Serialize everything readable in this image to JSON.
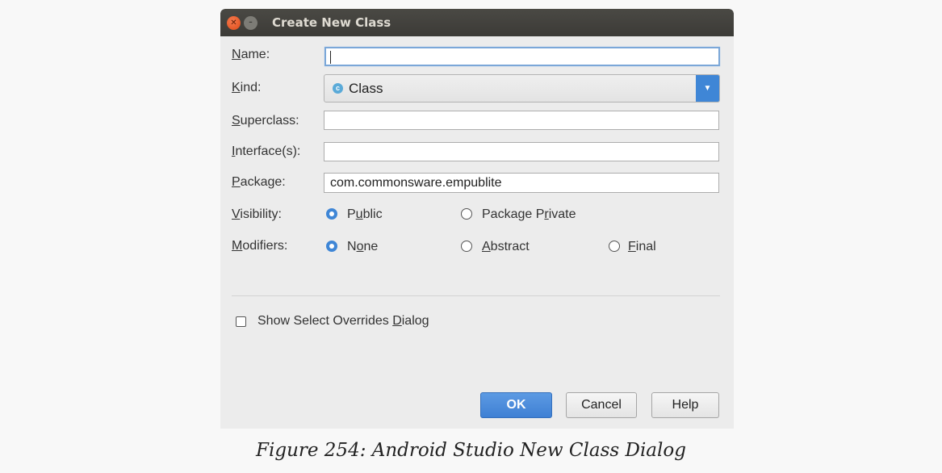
{
  "window": {
    "title": "Create New Class",
    "close_glyph": "✕",
    "minimize_glyph": "–"
  },
  "form": {
    "name": {
      "label_access": "N",
      "label_rest": "ame:",
      "value": ""
    },
    "kind": {
      "label_access": "K",
      "label_rest": "ind:",
      "icon_glyph": "c",
      "value": "Class",
      "arrow_glyph": "▼"
    },
    "superclass": {
      "label_access": "S",
      "label_rest": "uperclass:",
      "value": ""
    },
    "interfaces": {
      "label_access": "I",
      "label_rest": "nterface(s):",
      "value": ""
    },
    "package": {
      "label_access": "P",
      "label_rest": "ackage:",
      "value": "com.commonsware.empublite"
    },
    "visibility": {
      "label_access": "V",
      "label_rest": "isibility:",
      "options": [
        {
          "pre": "P",
          "access": "u",
          "post": "blic",
          "selected": true
        },
        {
          "pre": "Package P",
          "access": "r",
          "post": "ivate",
          "selected": false
        }
      ]
    },
    "modifiers": {
      "label_access": "M",
      "label_rest": "odifiers:",
      "options": [
        {
          "pre": "N",
          "access": "o",
          "post": "ne",
          "selected": true
        },
        {
          "pre": "",
          "access": "A",
          "post": "bstract",
          "selected": false
        },
        {
          "pre": "",
          "access": "F",
          "post": "inal",
          "selected": false
        }
      ]
    },
    "show_overrides": {
      "pre": "Show Select Overrides ",
      "access": "D",
      "post": "ialog",
      "checked": false
    }
  },
  "buttons": {
    "ok": "OK",
    "cancel": "Cancel",
    "help": "Help"
  },
  "caption": "Figure 254: Android Studio New Class Dialog",
  "colors": {
    "accent": "#3f86d6",
    "titlebar": "#3c3b37",
    "dialog_bg": "#ececec"
  }
}
